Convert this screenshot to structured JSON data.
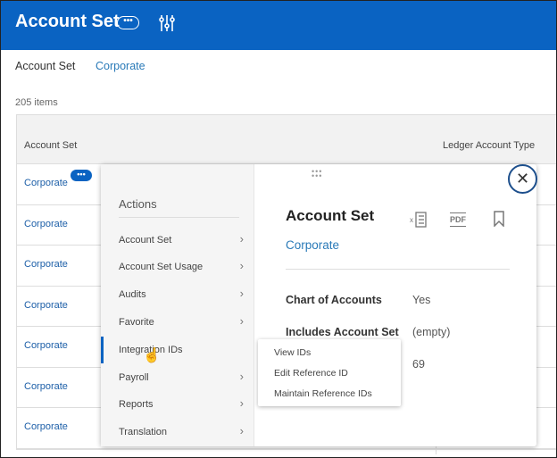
{
  "header": {
    "title": "Account Set",
    "more_icon": "ellipsis",
    "filter_icon": "sliders"
  },
  "breadcrumb": {
    "label": "Account Set",
    "value": "Corporate"
  },
  "item_count": "205 items",
  "table": {
    "columns": [
      "Account Set",
      "Ledger Account Type"
    ],
    "rows": [
      "Corporate",
      "Corporate",
      "Corporate",
      "Corporate",
      "Corporate",
      "Corporate",
      "Corporate"
    ]
  },
  "actions": {
    "title": "Actions",
    "items": [
      "Account Set",
      "Account Set Usage",
      "Audits",
      "Favorite",
      "Integration IDs",
      "Payroll",
      "Reports",
      "Translation"
    ]
  },
  "submenu": [
    "View IDs",
    "Edit Reference ID",
    "Maintain Reference IDs"
  ],
  "details": {
    "title": "Account Set",
    "subtitle": "Corporate",
    "fields": [
      {
        "label": "Chart of Accounts",
        "value": "Yes"
      },
      {
        "label": "Includes Account Set",
        "value": "(empty)"
      },
      {
        "label": "",
        "value": "69"
      }
    ],
    "pdf_label": "PDF"
  }
}
